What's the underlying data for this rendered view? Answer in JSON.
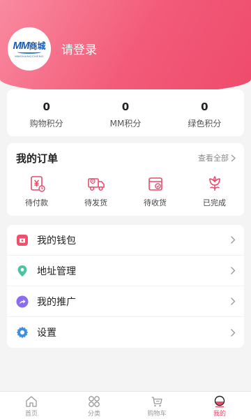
{
  "header": {
    "logo_mm": "MM",
    "logo_cn": "商城",
    "logo_sub": "MMSHANGCHENG",
    "login_text": "请登录"
  },
  "points": [
    {
      "value": "0",
      "label": "购物积分"
    },
    {
      "value": "0",
      "label": "MM积分"
    },
    {
      "value": "0",
      "label": "绿色积分"
    }
  ],
  "orders": {
    "title": "我的订单",
    "view_all": "查看全部",
    "items": [
      {
        "label": "待付款",
        "icon": "pending-payment-icon"
      },
      {
        "label": "待发货",
        "icon": "truck-icon"
      },
      {
        "label": "待收货",
        "icon": "box-check-icon"
      },
      {
        "label": "已完成",
        "icon": "flower-icon"
      }
    ]
  },
  "menu": [
    {
      "label": "我的钱包",
      "icon": "wallet-icon",
      "color": "#f0506e"
    },
    {
      "label": "地址管理",
      "icon": "location-pin-icon",
      "color": "#4cc3a4"
    },
    {
      "label": "我的推广",
      "icon": "share-icon",
      "color": "#8a6cf0"
    },
    {
      "label": "设置",
      "icon": "gear-icon",
      "color": "#3d8fe0"
    }
  ],
  "tabbar": [
    {
      "label": "首页",
      "icon": "home-icon",
      "active": false
    },
    {
      "label": "分类",
      "icon": "category-icon",
      "active": false
    },
    {
      "label": "购物车",
      "icon": "cart-icon",
      "active": false
    },
    {
      "label": "我的",
      "icon": "profile-icon",
      "active": true
    }
  ],
  "colors": {
    "accent": "#ef4b6c",
    "header_gradient_start": "#f98aa0",
    "wallet": "#f0506e",
    "address": "#4cc3a4",
    "promotion": "#8a6cf0",
    "settings": "#3d8fe0"
  }
}
